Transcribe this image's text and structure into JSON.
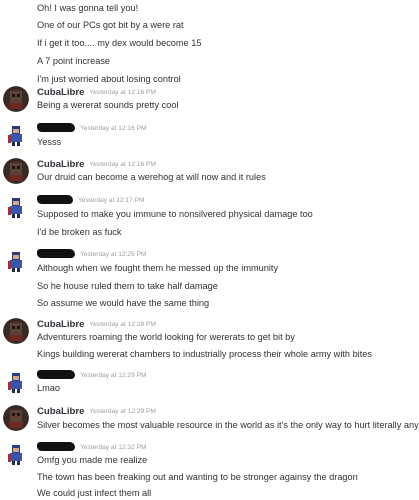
{
  "intro_lines": [
    "Oh! I was gonna tell you!",
    "One of our PCs got bit by a were rat",
    "If i get it too.... my dex would become 15",
    "A 7 point increase",
    "I'm just worried about losing control"
  ],
  "messages": [
    {
      "author": "CubaLibre",
      "timestamp": "Yesterday at 12:16 PM",
      "lines": [
        "Being a wererat sounds pretty cool"
      ]
    },
    {
      "author": "",
      "timestamp": "Yesterday at 12:16 PM",
      "lines": [
        "Yesss"
      ]
    },
    {
      "author": "CubaLibre",
      "timestamp": "Yesterday at 12:16 PM",
      "lines": [
        "Our druid can become a werehog at will now and it rules"
      ]
    },
    {
      "author": "",
      "timestamp": "Yesterday at 12:17 PM",
      "lines": [
        "Supposed to make you immune to nonsilvered physical damage too",
        "I'd be broken as fuck"
      ]
    },
    {
      "author": "",
      "timestamp": "Yesterday at 12:25 PM",
      "lines": [
        "Although when we fought them he messed up the immunity",
        "So he house ruled them to take half damage",
        "So assume we would have the same thing"
      ]
    },
    {
      "author": "CubaLibre",
      "timestamp": "Yesterday at 12:28 PM",
      "lines": [
        "Adventurers roaming the world looking for wererats to get bit by",
        "Kings building wererat chambers to industrially process their whole army with bites"
      ]
    },
    {
      "author": "",
      "timestamp": "Yesterday at 12:29 PM",
      "lines": [
        "Lmao"
      ]
    },
    {
      "author": "CubaLibre",
      "timestamp": "Yesterday at 12:29 PM",
      "lines": [
        "Silver becomes the most valuable resource in the world as it's the only way to hurt literally anybody"
      ]
    },
    {
      "author": "",
      "timestamp": "Yesterday at 12:32 PM",
      "lines": [
        "Omfg you made me realize",
        "The town has been freaking out and wanting to be stronger againsy the dragon",
        "We could just infect them all"
      ]
    }
  ]
}
